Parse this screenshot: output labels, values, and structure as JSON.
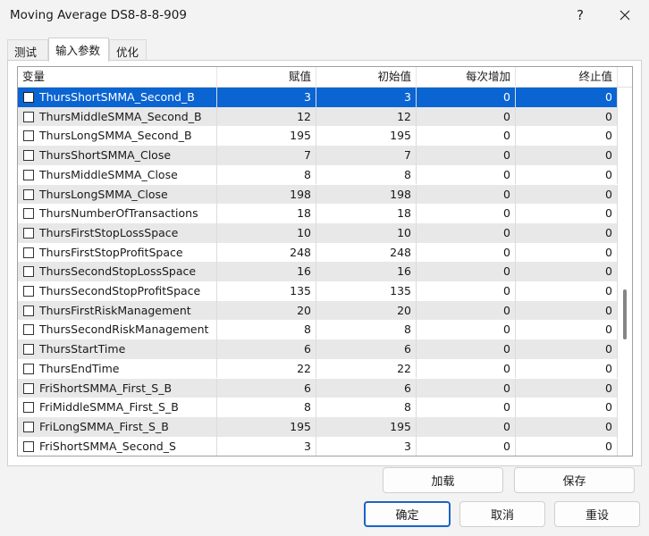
{
  "window": {
    "title": "Moving Average DS8-8-8-909",
    "help_label": "?"
  },
  "tabs": [
    {
      "label": "测试"
    },
    {
      "label": "输入参数"
    },
    {
      "label": "优化"
    }
  ],
  "table": {
    "columns": [
      "变量",
      "赋值",
      "初始值",
      "每次增加",
      "终止值"
    ],
    "rows": [
      {
        "name": "ThursShortSMMA_Second_B",
        "value": "3",
        "start": "3",
        "step": "0",
        "stop": "0"
      },
      {
        "name": "ThursMiddleSMMA_Second_B",
        "value": "12",
        "start": "12",
        "step": "0",
        "stop": "0"
      },
      {
        "name": "ThursLongSMMA_Second_B",
        "value": "195",
        "start": "195",
        "step": "0",
        "stop": "0"
      },
      {
        "name": "ThursShortSMMA_Close",
        "value": "7",
        "start": "7",
        "step": "0",
        "stop": "0"
      },
      {
        "name": "ThursMiddleSMMA_Close",
        "value": "8",
        "start": "8",
        "step": "0",
        "stop": "0"
      },
      {
        "name": "ThursLongSMMA_Close",
        "value": "198",
        "start": "198",
        "step": "0",
        "stop": "0"
      },
      {
        "name": "ThursNumberOfTransactions",
        "value": "18",
        "start": "18",
        "step": "0",
        "stop": "0"
      },
      {
        "name": "ThursFirstStopLossSpace",
        "value": "10",
        "start": "10",
        "step": "0",
        "stop": "0"
      },
      {
        "name": "ThursFirstStopProfitSpace",
        "value": "248",
        "start": "248",
        "step": "0",
        "stop": "0"
      },
      {
        "name": "ThursSecondStopLossSpace",
        "value": "16",
        "start": "16",
        "step": "0",
        "stop": "0"
      },
      {
        "name": "ThursSecondStopProfitSpace",
        "value": "135",
        "start": "135",
        "step": "0",
        "stop": "0"
      },
      {
        "name": "ThursFirstRiskManagement",
        "value": "20",
        "start": "20",
        "step": "0",
        "stop": "0"
      },
      {
        "name": "ThursSecondRiskManagement",
        "value": "8",
        "start": "8",
        "step": "0",
        "stop": "0"
      },
      {
        "name": "ThursStartTime",
        "value": "6",
        "start": "6",
        "step": "0",
        "stop": "0"
      },
      {
        "name": "ThursEndTime",
        "value": "22",
        "start": "22",
        "step": "0",
        "stop": "0"
      },
      {
        "name": "FriShortSMMA_First_S_B",
        "value": "6",
        "start": "6",
        "step": "0",
        "stop": "0"
      },
      {
        "name": "FriMiddleSMMA_First_S_B",
        "value": "8",
        "start": "8",
        "step": "0",
        "stop": "0"
      },
      {
        "name": "FriLongSMMA_First_S_B",
        "value": "195",
        "start": "195",
        "step": "0",
        "stop": "0"
      },
      {
        "name": "FriShortSMMA_Second_S",
        "value": "3",
        "start": "3",
        "step": "0",
        "stop": "0"
      }
    ]
  },
  "buttons": {
    "load": "加载",
    "save": "保存",
    "ok": "确定",
    "cancel": "取消",
    "reset": "重设"
  },
  "colors": {
    "selection": "#0a64d2",
    "row_alt": "#e8e8e8",
    "primary_border": "#1a64c8"
  }
}
